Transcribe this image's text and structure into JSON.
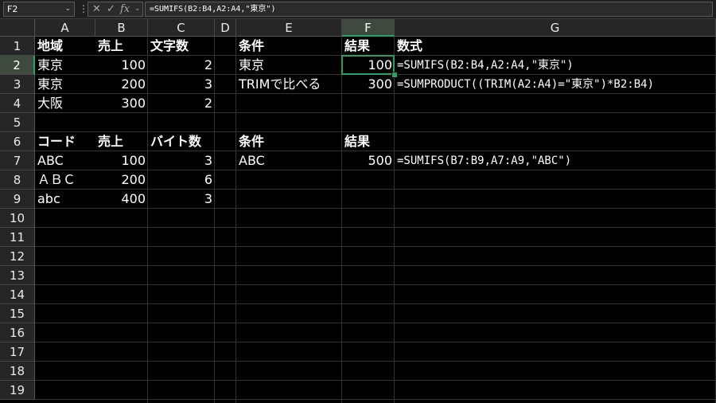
{
  "formula_bar": {
    "name_box": "F2",
    "formula": "=SUMIFS(B2:B4,A2:A4,\"東京\")",
    "icons": [
      "cancel-icon",
      "enter-check-icon",
      "function-fx-icon"
    ]
  },
  "columns": [
    "A",
    "B",
    "C",
    "D",
    "E",
    "F",
    "G"
  ],
  "rows": [
    "1",
    "2",
    "3",
    "4",
    "5",
    "6",
    "7",
    "8",
    "9",
    "10",
    "11",
    "12",
    "13",
    "14",
    "15",
    "16",
    "17",
    "18",
    "19"
  ],
  "active_cell": "F2",
  "cells": {
    "A1": "地域",
    "B1": "売上",
    "C1": "文字数",
    "E1": "条件",
    "F1": "結果",
    "G1": "数式",
    "A2": "東京",
    "B2": "100",
    "C2": "2",
    "E2": "東京",
    "F2": "100",
    "G2": "=SUMIFS(B2:B4,A2:A4,\"東京\")",
    "A3": "東京",
    "B3": "200",
    "C3": "3",
    "E3": "TRIMで比べる",
    "F3": "300",
    "G3": "=SUMPRODUCT((TRIM(A2:A4)=\"東京\")*B2:B4)",
    "A4": "大阪",
    "B4": "300",
    "C4": "2",
    "A6": "コード",
    "B6": "売上",
    "C6": "バイト数",
    "E6": "条件",
    "F6": "結果",
    "A7": "ABC",
    "B7": "100",
    "C7": "3",
    "E7": "ABC",
    "F7": "500",
    "G7": "=SUMIFS(B7:B9,A7:A9,\"ABC\")",
    "A8": "ＡＢＣ",
    "B8": "200",
    "C8": "6",
    "A9": "abc",
    "B9": "400",
    "C9": "3"
  }
}
